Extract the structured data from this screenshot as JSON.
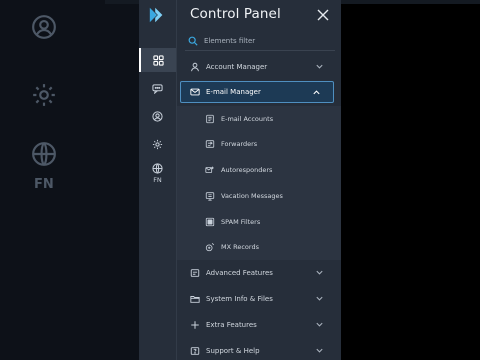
{
  "panel": {
    "title": "Control Panel",
    "search_placeholder": "Elements filter"
  },
  "rail": {
    "items": [
      "grid-icon",
      "chat-icon",
      "user-circle-icon",
      "gear-icon",
      "globe-icon"
    ],
    "fn_label": "FN"
  },
  "background": {
    "fn_label": "FN"
  },
  "menu": {
    "account_manager": "Account Manager",
    "email_manager": "E-mail Manager",
    "advanced_features": "Advanced Features",
    "system_info": "System Info & Files",
    "extra_features": "Extra Features",
    "support_help": "Support & Help"
  },
  "submenu": {
    "email_accounts": "E-mail Accounts",
    "forwarders": "Forwarders",
    "autoresponders": "Autoresponders",
    "vacation_messages": "Vacation Messages",
    "spam_filters": "SPAM Filters",
    "mx_records": "MX Records"
  },
  "colors": {
    "panel_bg": "#262e3a",
    "selected_bg": "#1d3a55",
    "selected_border": "#4f8fc0",
    "logo": "#3aa8e0"
  }
}
